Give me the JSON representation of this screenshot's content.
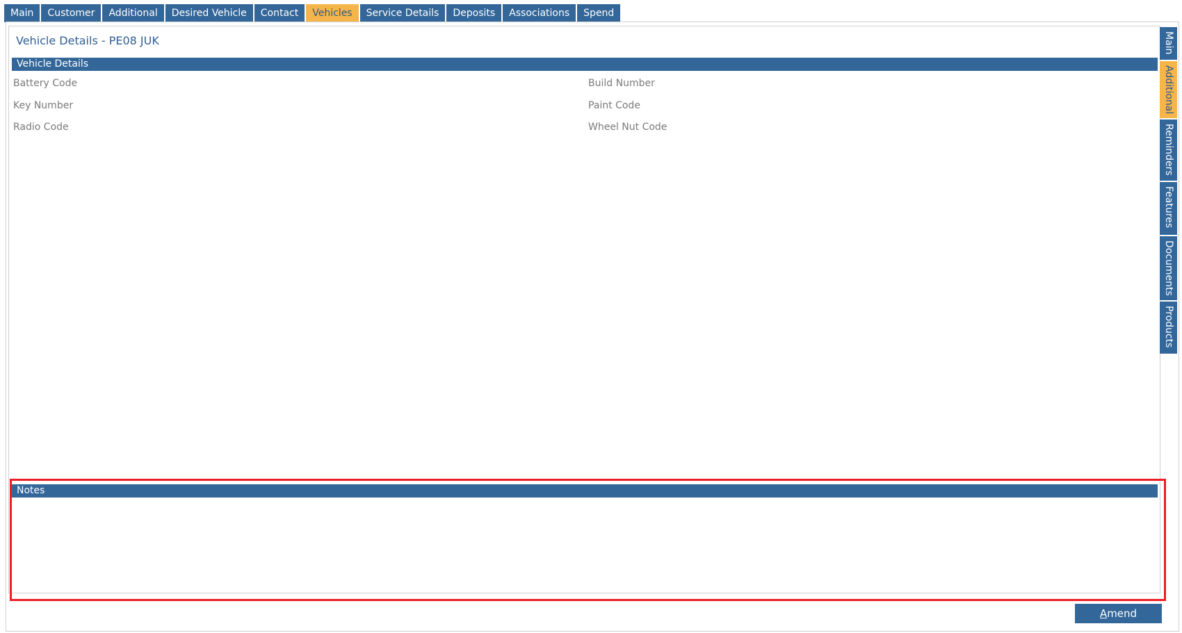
{
  "top_tabs": [
    {
      "label": "Main"
    },
    {
      "label": "Customer"
    },
    {
      "label": "Additional"
    },
    {
      "label": "Desired Vehicle"
    },
    {
      "label": "Contact"
    },
    {
      "label": "Vehicles",
      "active": true
    },
    {
      "label": "Service Details"
    },
    {
      "label": "Deposits"
    },
    {
      "label": "Associations"
    },
    {
      "label": "Spend"
    }
  ],
  "page_title": "Vehicle Details - PE08 JUK",
  "vehicle_details": {
    "header": "Vehicle Details",
    "left_fields": [
      "Battery Code",
      "Key Number",
      "Radio Code"
    ],
    "right_fields": [
      "Build Number",
      "Paint Code",
      "Wheel Nut Code"
    ]
  },
  "notes": {
    "header": "Notes",
    "value": ""
  },
  "side_tabs": [
    {
      "label": "Main"
    },
    {
      "label": "Additional",
      "active": true
    },
    {
      "label": "Reminders"
    },
    {
      "label": "Features"
    },
    {
      "label": "Documents"
    },
    {
      "label": "Products"
    }
  ],
  "amend_button": {
    "first": "A",
    "rest": "mend"
  },
  "colors": {
    "tab_blue": "#336699",
    "tab_active": "#f5b54a",
    "title_blue": "#2f5f95",
    "highlight_red": "#ee1c24"
  }
}
